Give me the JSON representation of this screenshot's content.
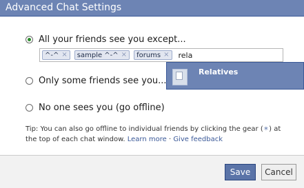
{
  "dialog": {
    "title": "Advanced Chat Settings"
  },
  "options": [
    {
      "label": "All your friends see you except...",
      "selected": true
    },
    {
      "label": "Only some friends see you...",
      "selected": false
    },
    {
      "label": "No one sees you (go offline)",
      "selected": false
    }
  ],
  "token_field": {
    "tokens": [
      "^-^",
      "sample ^-^",
      "forums"
    ],
    "remove_glyph": "×",
    "typed_text": "rela"
  },
  "suggestion": {
    "label": "Relatives",
    "icon": "list-icon"
  },
  "tip": {
    "text": "Tip: You can also go offline to individual friends by clicking the gear (",
    "gear_glyph": "✶",
    "text_after": ") at the top of each chat window.",
    "learn_more": "Learn more",
    "separator": "·",
    "feedback": "Give feedback"
  },
  "buttons": {
    "save": "Save",
    "cancel": "Cancel"
  },
  "colors": {
    "header": "#6d84b4",
    "link": "#3b5998",
    "save_button": "#5b74a8"
  }
}
